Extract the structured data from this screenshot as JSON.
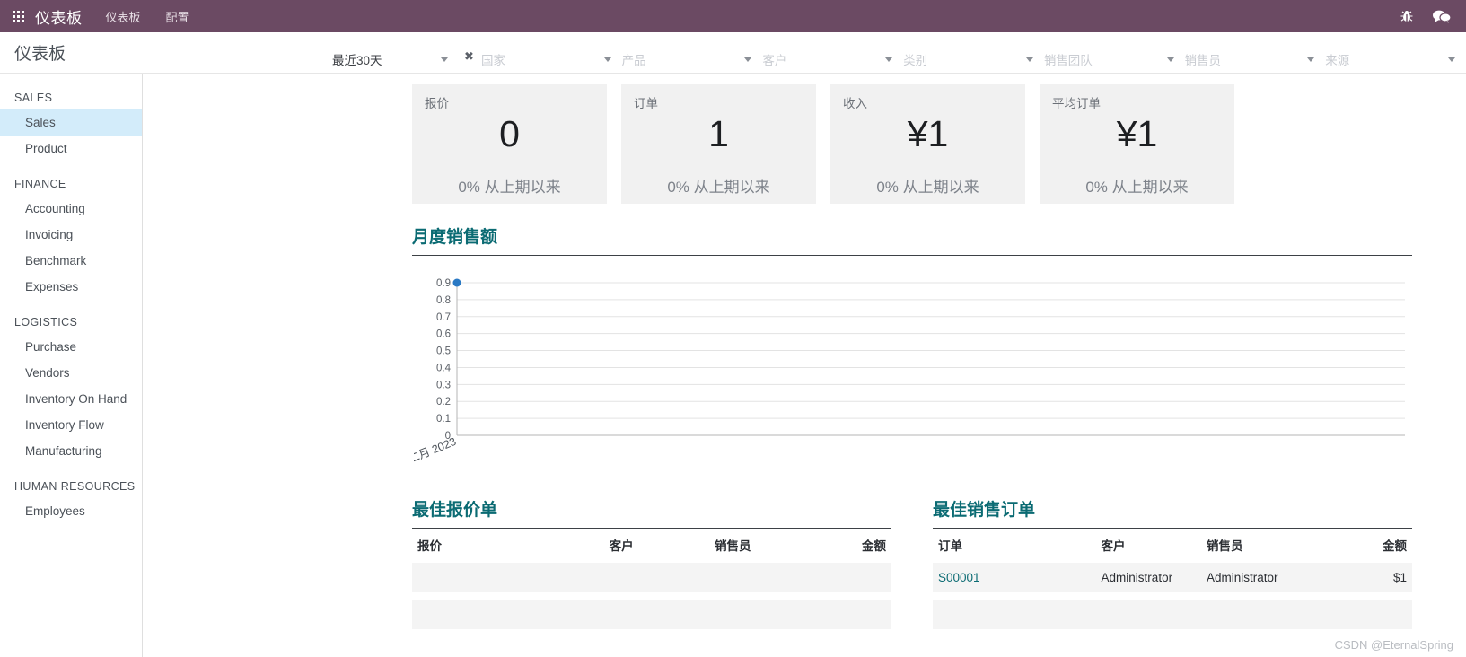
{
  "navbar": {
    "apps_icon": "apps-grid-icon",
    "brand": "仪表板",
    "items": [
      {
        "label": "仪表板",
        "name": "nav-item-dashboard"
      },
      {
        "label": "配置",
        "name": "nav-item-configuration"
      }
    ],
    "right_icons": [
      {
        "name": "bug-icon",
        "glyph": "🐞"
      },
      {
        "name": "messages-icon",
        "glyph": "💬"
      }
    ],
    "bg_color": "#6b4a63"
  },
  "control_panel": {
    "title": "仪表板",
    "filters": [
      {
        "name": "filter-date-range",
        "value": "最近30天",
        "placeholder": "",
        "clearable": true
      },
      {
        "name": "filter-country",
        "value": "",
        "placeholder": "国家",
        "clearable": false
      },
      {
        "name": "filter-product",
        "value": "",
        "placeholder": "产品",
        "clearable": false
      },
      {
        "name": "filter-customer",
        "value": "",
        "placeholder": "客户",
        "clearable": false
      },
      {
        "name": "filter-category",
        "value": "",
        "placeholder": "类别",
        "clearable": false
      },
      {
        "name": "filter-sales-team",
        "value": "",
        "placeholder": "销售团队",
        "clearable": false
      },
      {
        "name": "filter-salesperson",
        "value": "",
        "placeholder": "销售员",
        "clearable": false
      },
      {
        "name": "filter-source",
        "value": "",
        "placeholder": "来源",
        "clearable": false
      }
    ],
    "clear_glyph": "✖"
  },
  "sidebar": {
    "groups": [
      {
        "title": "SALES",
        "items": [
          {
            "label": "Sales",
            "active": true
          },
          {
            "label": "Product",
            "active": false
          }
        ]
      },
      {
        "title": "FINANCE",
        "items": [
          {
            "label": "Accounting",
            "active": false
          },
          {
            "label": "Invoicing",
            "active": false
          },
          {
            "label": "Benchmark",
            "active": false
          },
          {
            "label": "Expenses",
            "active": false
          }
        ]
      },
      {
        "title": "LOGISTICS",
        "items": [
          {
            "label": "Purchase",
            "active": false
          },
          {
            "label": "Vendors",
            "active": false
          },
          {
            "label": "Inventory On Hand",
            "active": false
          },
          {
            "label": "Inventory Flow",
            "active": false
          },
          {
            "label": "Manufacturing",
            "active": false
          }
        ]
      },
      {
        "title": "HUMAN RESOURCES",
        "items": [
          {
            "label": "Employees",
            "active": false
          }
        ]
      }
    ]
  },
  "kpis": [
    {
      "name": "kpi-quotations",
      "label": "报价",
      "value": "0",
      "delta": "0% 从上期以来"
    },
    {
      "name": "kpi-orders",
      "label": "订单",
      "value": "1",
      "delta": "0% 从上期以来"
    },
    {
      "name": "kpi-revenue",
      "label": "收入",
      "value": "¥1",
      "delta": "0% 从上期以来"
    },
    {
      "name": "kpi-avg-order",
      "label": "平均订单",
      "value": "¥1",
      "delta": "0% 从上期以来"
    }
  ],
  "chart_section": {
    "title": "月度销售额"
  },
  "chart_data": {
    "type": "line",
    "title": "月度销售额",
    "xlabel": "",
    "ylabel": "",
    "categories": [
      "二月 2023"
    ],
    "x_tick_labels": [
      "二月 2023"
    ],
    "values": [
      0.9
    ],
    "series": [
      {
        "name": "月度销售额",
        "values": [
          0.9
        ],
        "color": "#2a79c4"
      }
    ],
    "ylim": [
      0,
      0.9
    ],
    "y_tick_labels": [
      "0",
      "0.1",
      "0.2",
      "0.3",
      "0.4",
      "0.5",
      "0.6",
      "0.7",
      "0.8",
      "0.9"
    ],
    "y_ticks": [
      0,
      0.1,
      0.2,
      0.3,
      0.4,
      0.5,
      0.6,
      0.7,
      0.8,
      0.9
    ],
    "grid": true,
    "legend": false,
    "point_color": "#2a79c4",
    "grid_color": "#e3e3e3",
    "axis_color": "#b5b5b5"
  },
  "quotations_table": {
    "title": "最佳报价单",
    "columns": [
      "报价",
      "客户",
      "销售员",
      "金额"
    ],
    "rows": []
  },
  "orders_table": {
    "title": "最佳销售订单",
    "columns": [
      "订单",
      "客户",
      "销售员",
      "金额"
    ],
    "rows": [
      {
        "order": "S00001",
        "customer": "Administrator",
        "salesperson": "Administrator",
        "amount": "$1"
      }
    ]
  },
  "watermark": "CSDN @EternalSpring",
  "colors": {
    "navbar": "#6b4a63",
    "accent_teal": "#0b6b73",
    "sidebar_active": "#d3ecfa",
    "kpi_bg": "#f1f1f1",
    "table_row_bg": "#f4f4f4"
  }
}
